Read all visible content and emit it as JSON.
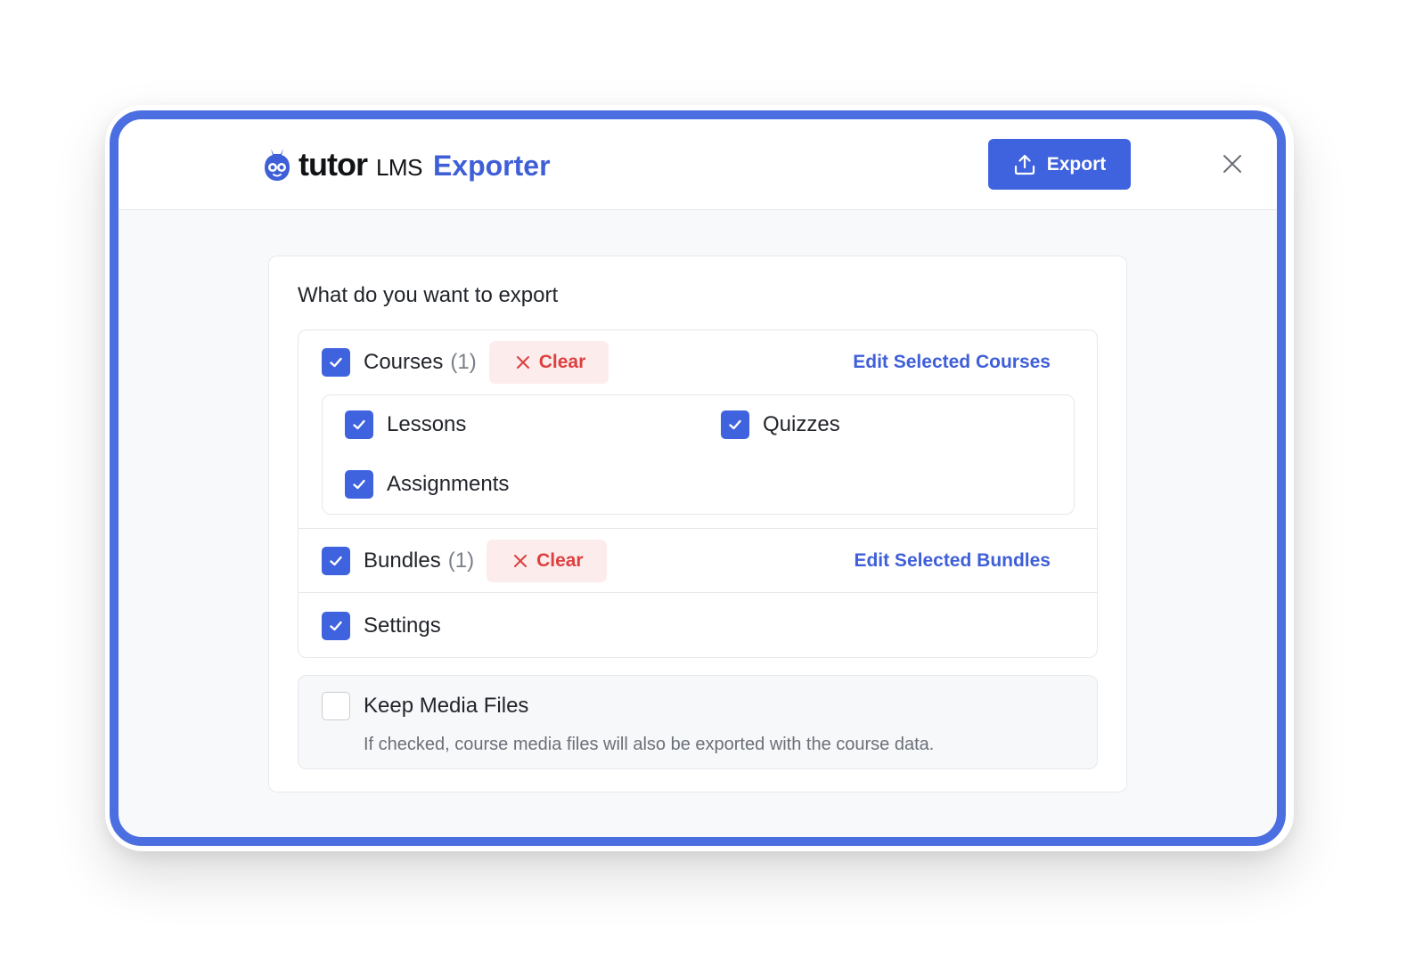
{
  "header": {
    "logo_tutor": "tutor",
    "logo_lms": "LMS",
    "logo_exporter": "Exporter",
    "export_label": "Export"
  },
  "card": {
    "title": "What do you want to export"
  },
  "options": {
    "courses": {
      "label": "Courses",
      "count": "(1)",
      "checked": true,
      "clear_label": "Clear",
      "edit_label": "Edit Selected Courses"
    },
    "sub_items": [
      {
        "label": "Lessons",
        "checked": true
      },
      {
        "label": "Quizzes",
        "checked": true
      },
      {
        "label": "Assignments",
        "checked": true
      }
    ],
    "bundles": {
      "label": "Bundles",
      "count": "(1)",
      "checked": true,
      "clear_label": "Clear",
      "edit_label": "Edit Selected Bundles"
    },
    "settings": {
      "label": "Settings",
      "checked": true
    }
  },
  "media": {
    "label": "Keep Media Files",
    "checked": false,
    "description": "If checked, course media files will also be exported with the course data."
  },
  "colors": {
    "accent": "#3f63de",
    "frame_border": "#4b6ee0",
    "clear_text": "#dc4040",
    "clear_bg": "#fdecec"
  }
}
